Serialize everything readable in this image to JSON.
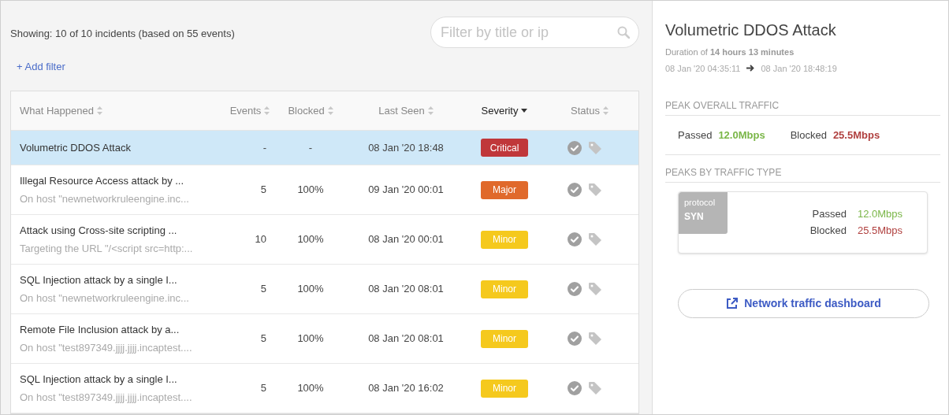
{
  "summary": "Showing: 10 of 10 incidents  (based on 55 events)",
  "add_filter": "+ Add filter",
  "search": {
    "placeholder": "Filter by title or ip"
  },
  "table": {
    "columns": [
      {
        "label": "What Happened",
        "sorted": false
      },
      {
        "label": "Events",
        "sorted": false
      },
      {
        "label": "Blocked",
        "sorted": false
      },
      {
        "label": "Last Seen",
        "sorted": false
      },
      {
        "label": "Severity",
        "sorted": true
      },
      {
        "label": "Status",
        "sorted": false
      }
    ],
    "rows": [
      {
        "title": "Volumetric DDOS Attack",
        "subtitle": "",
        "events": "-",
        "blocked": "-",
        "last_seen": "08 Jan '20 18:48",
        "severity": "Critical",
        "color": "#c0373a",
        "selected": true
      },
      {
        "title": "Illegal Resource Access attack by ...",
        "subtitle": "On host \"newnetworkruleengine.inc...",
        "events": "5",
        "blocked": "100%",
        "last_seen": "09 Jan '20 00:01",
        "severity": "Major",
        "color": "#e0692b",
        "selected": false
      },
      {
        "title": "Attack using Cross-site scripting ...",
        "subtitle": "Targeting the URL \"/<script src=http:...",
        "events": "10",
        "blocked": "100%",
        "last_seen": "08 Jan '20 00:01",
        "severity": "Minor",
        "color": "#f5c91d",
        "selected": false
      },
      {
        "title": "SQL Injection attack by a single I...",
        "subtitle": "On host \"newnetworkruleengine.inc...",
        "events": "5",
        "blocked": "100%",
        "last_seen": "08 Jan '20 08:01",
        "severity": "Minor",
        "color": "#f5c91d",
        "selected": false
      },
      {
        "title": "Remote File Inclusion attack by a...",
        "subtitle": "On host \"test897349.jjjj.jjjj.incaptest....",
        "events": "5",
        "blocked": "100%",
        "last_seen": "08 Jan '20 08:01",
        "severity": "Minor",
        "color": "#f5c91d",
        "selected": false
      },
      {
        "title": "SQL Injection attack by a single I...",
        "subtitle": "On host \"test897349.jjjj.jjjj.incaptest....",
        "events": "5",
        "blocked": "100%",
        "last_seen": "08 Jan '20 16:02",
        "severity": "Minor",
        "color": "#f5c91d",
        "selected": false
      }
    ]
  },
  "detail": {
    "title": "Volumetric DDOS Attack",
    "duration": "Duration of **14 hours 13 minutes**",
    "start": "08 Jan '20 04:35:11",
    "end": "08 Jan '20 18:48:19",
    "peak_overall": {
      "heading": "PEAK OVERALL TRAFFIC",
      "passed_label": "Passed",
      "passed": "12.0Mbps",
      "blocked_label": "Blocked",
      "blocked": "25.5Mbps"
    },
    "peaks_by_type": {
      "heading": "PEAKS BY TRAFFIC TYPE",
      "cards": [
        {
          "type_label": "protocol",
          "type": "SYN",
          "passed_label": "Passed",
          "passed": "12.0Mbps",
          "blocked_label": "Blocked",
          "blocked": "25.5Mbps"
        }
      ]
    },
    "dashboard_button": "Network traffic dashboard"
  }
}
